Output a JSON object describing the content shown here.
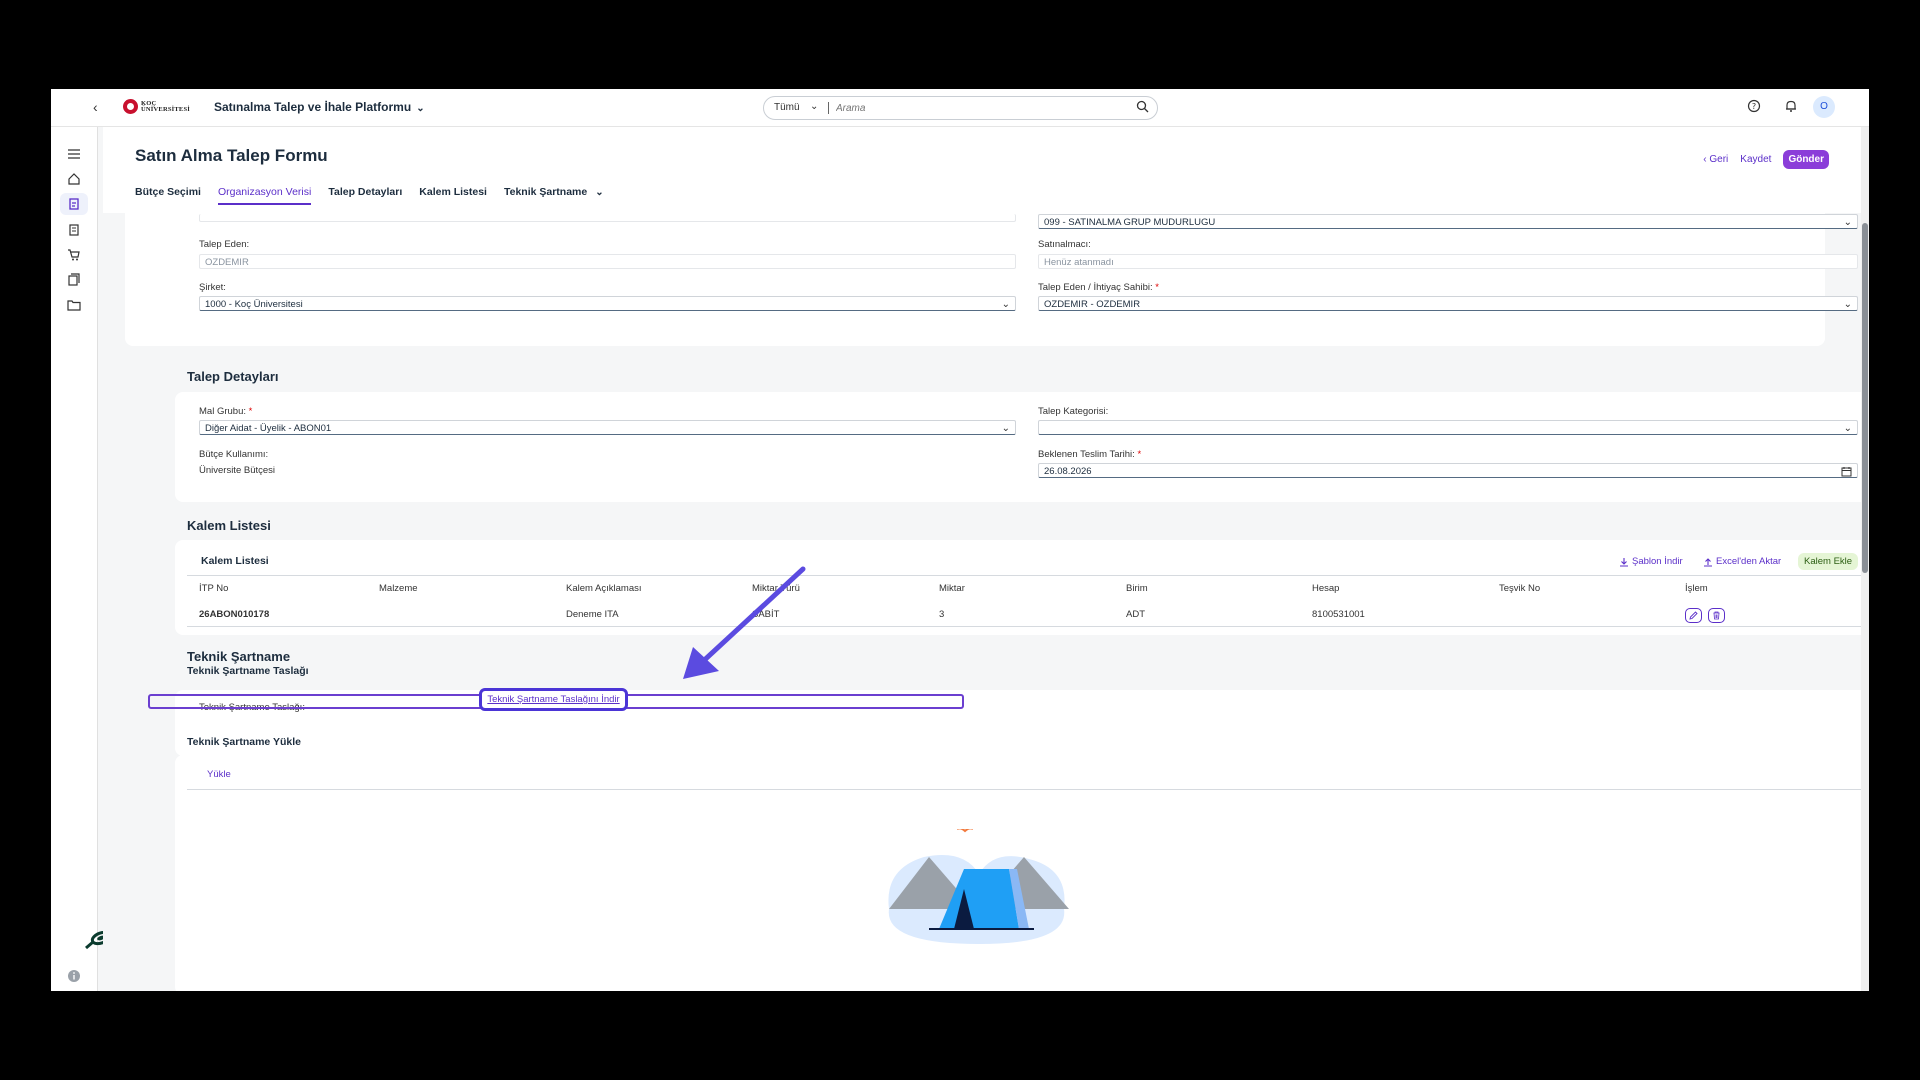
{
  "shell": {
    "logo_text_1": "KOÇ",
    "logo_text_2": "ÜNİVERSİTESİ",
    "product": "Satınalma Talep ve İhale Platformu",
    "search_scope": "Tümü",
    "search_placeholder": "Arama",
    "avatar_initial": "O"
  },
  "page": {
    "title": "Satın Alma Talep Formu",
    "actions": {
      "back": "Geri",
      "save": "Kaydet",
      "send": "Gönder"
    },
    "tabs": [
      "Bütçe Seçimi",
      "Organizasyon Verisi",
      "Talep Detayları",
      "Kalem Listesi",
      "Teknik Şartname"
    ]
  },
  "org": {
    "top_right_value": "099 - SATINALMA GRUP MUDURLUGU",
    "talep_eden_label": "Talep Eden:",
    "talep_eden_value": "OZDEMIR",
    "satinalmaci_label": "Satınalmacı:",
    "satinalmaci_placeholder": "Henüz atanmadı",
    "sirket_label": "Şirket:",
    "sirket_value": "1000 - Koç Üniversitesi",
    "ihtiyac_label": "Talep Eden / İhtiyaç Sahibi:",
    "ihtiyac_value": "OZDEMIR - OZDEMIR"
  },
  "talep": {
    "title": "Talep Detayları",
    "mal_grubu_label": "Mal Grubu:",
    "mal_grubu_value": "Diğer Aidat - Üyelik - ABON01",
    "kategori_label": "Talep Kategorisi:",
    "butce_label": "Bütçe Kullanımı:",
    "butce_value": "Üniversite Bütçesi",
    "teslim_label": "Beklenen Teslim Tarihi:",
    "teslim_value": "26.08.2026"
  },
  "kalem": {
    "title": "Kalem Listesi",
    "table_title": "Kalem Listesi",
    "actions": {
      "sablon": "Şablon İndir",
      "excel": "Excel'den Aktar",
      "ekle": "Kalem Ekle"
    },
    "columns": [
      "İTP No",
      "Malzeme",
      "Kalem Açıklaması",
      "Miktar Türü",
      "Miktar",
      "Birim",
      "Hesap",
      "Teşvik No",
      "İşlem"
    ],
    "rows": [
      [
        "26ABON010178",
        "",
        "Deneme ITA",
        "SABİT",
        "3",
        "ADT",
        "8100531001",
        ""
      ]
    ]
  },
  "teknik": {
    "title": "Teknik Şartname",
    "taslak_title": "Teknik Şartname Taslağı",
    "taslak_label": "Teknik Şartname Taslağı:",
    "download_link": "Teknik Şartname Taslağını İndir",
    "yukle_title": "Teknik Şartname Yükle",
    "yukle_tab": "Yükle"
  }
}
